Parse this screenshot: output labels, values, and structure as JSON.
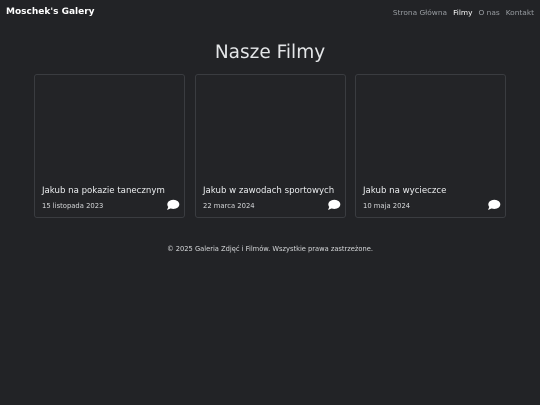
{
  "navbar": {
    "brand": "Moschek's Galery",
    "links": [
      {
        "label": "Strona Główna",
        "active": false
      },
      {
        "label": "Filmy",
        "active": true
      },
      {
        "label": "O nas",
        "active": false
      },
      {
        "label": "Kontakt",
        "active": false
      }
    ]
  },
  "main": {
    "title": "Nasze Filmy",
    "cards": [
      {
        "title": "Jakub na pokazie tanecznym",
        "date": "15 listopada 2023",
        "icon": "comment-icon"
      },
      {
        "title": "Jakub w zawodach sportowych",
        "date": "22 marca 2024",
        "icon": "comment-icon"
      },
      {
        "title": "Jakub na wycieczce",
        "date": "10 maja 2024",
        "icon": "comment-icon"
      }
    ]
  },
  "footer": {
    "text": "© 2025 Galeria Zdjęć i Filmów. Wszystkie prawa zastrzeżone."
  },
  "colors": {
    "background": "#222326",
    "card_border": "#3a3c40",
    "nav_link": "#9a9ea3",
    "nav_active": "#ffffff"
  }
}
